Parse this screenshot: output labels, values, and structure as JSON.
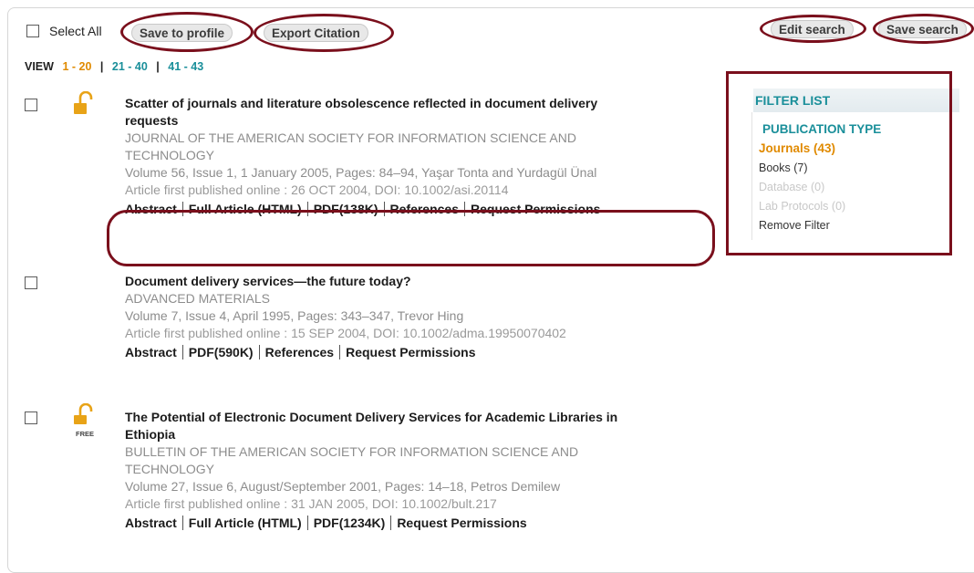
{
  "toolbar": {
    "select_all_label": "Select All",
    "save_profile_label": "Save to profile",
    "export_citation_label": "Export Citation",
    "edit_search_label": "Edit search",
    "save_search_label": "Save search"
  },
  "pagination": {
    "view_label": "VIEW",
    "current": "1 - 20",
    "pages": [
      "21 - 40",
      "41 - 43"
    ]
  },
  "results": [
    {
      "title_line1": "Scatter of journals and literature obsolescence reflected in document delivery",
      "title_line2": "requests",
      "journal_line1": "JOURNAL OF THE AMERICAN SOCIETY FOR INFORMATION SCIENCE AND",
      "journal_line2": "TECHNOLOGY",
      "details": "Volume 56, Issue 1, 1 January 2005, Pages: 84–94, Yaşar Tonta and Yurdagül Ünal",
      "published": "Article first published online : 26 OCT 2004, DOI: 10.1002/asi.20114",
      "links": [
        "Abstract",
        "Full Article (HTML)",
        "PDF(138K)",
        "References",
        "Request Permissions"
      ]
    },
    {
      "title_line1": "Document delivery services—the future today?",
      "journal_line1": "ADVANCED MATERIALS",
      "details": "Volume 7, Issue 4, April 1995, Pages: 343–347, Trevor Hing",
      "published": "Article first published online : 15 SEP 2004, DOI: 10.1002/adma.19950070402",
      "links": [
        "Abstract",
        "PDF(590K)",
        "References",
        "Request Permissions"
      ]
    },
    {
      "badge": "FREE",
      "title_line1": "The Potential of Electronic Document Delivery Services for Academic Libraries in",
      "title_line2": "Ethiopia",
      "journal_line1": "BULLETIN OF THE AMERICAN SOCIETY FOR INFORMATION SCIENCE AND",
      "journal_line2": "TECHNOLOGY",
      "details": "Volume 27, Issue 6, August/September 2001, Pages: 14–18, Petros Demilew",
      "published": "Article first published online : 31 JAN 2005, DOI: 10.1002/bult.217",
      "links": [
        "Abstract",
        "Full Article (HTML)",
        "PDF(1234K)",
        "Request Permissions"
      ]
    }
  ],
  "filter": {
    "title": "FILTER LIST",
    "section": "PUBLICATION TYPE",
    "items": [
      "Journals (43)",
      "Books (7)",
      "Database (0)",
      "Lab Protocols (0)"
    ],
    "remove_label": "Remove Filter"
  },
  "icons": {
    "lock": "open-lock-icon",
    "lock_color": "#e8a317"
  },
  "colors": {
    "annotation": "#7a0f1c",
    "accent": "#1a8f9a",
    "active": "#e08a00",
    "disabled": "#c8c8c8"
  }
}
